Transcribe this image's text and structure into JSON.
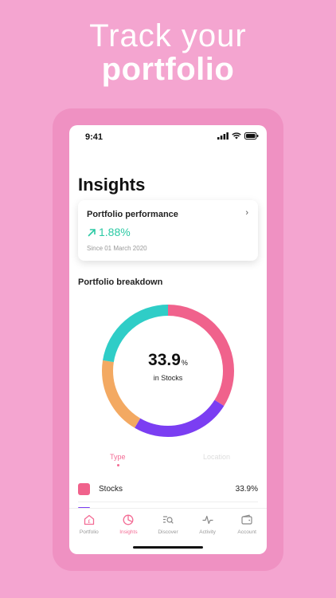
{
  "headline": {
    "line1": "Track your",
    "line2": "portfolio"
  },
  "status_bar": {
    "time": "9:41"
  },
  "page": {
    "title": "Insights"
  },
  "performance_card": {
    "title": "Portfolio performance",
    "value": "1.88%",
    "since": "Since 01 March 2020",
    "value_color": "#2bc9a4"
  },
  "breakdown": {
    "title": "Portfolio breakdown",
    "center_value": "33.9",
    "center_unit": "%",
    "center_caption": "in Stocks",
    "segments": [
      {
        "fraction": 0.339,
        "color": "#f0628c"
      },
      {
        "fraction": 0.245,
        "color": "#7b3ef2"
      },
      {
        "fraction": 0.191,
        "color": "#f3a962"
      },
      {
        "fraction": 0.225,
        "color": "#2fcdc7"
      }
    ]
  },
  "tabs": {
    "type": "Type",
    "location": "Location"
  },
  "legend": [
    {
      "label": "Stocks",
      "value": "33.9%",
      "color": "#f0628c"
    }
  ],
  "nav": {
    "portfolio": "Portfolio",
    "insights": "Insights",
    "discover": "Discover",
    "activity": "Activity",
    "account": "Account"
  },
  "colors": {
    "background": "#f4a5d0",
    "accent": "#f36b94"
  }
}
